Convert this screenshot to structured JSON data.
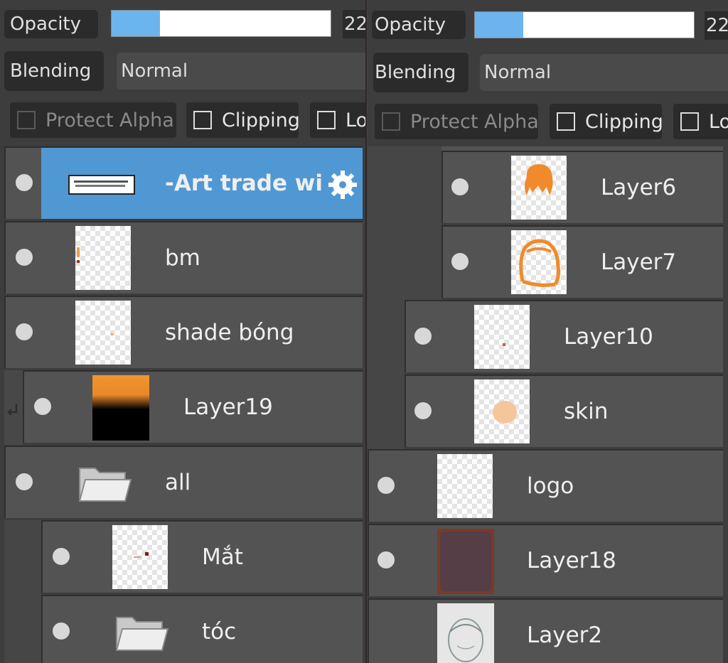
{
  "left": {
    "opacity_label": "Opacity",
    "opacity_value": "22",
    "opacity_fraction": 0.22,
    "blending_label": "Blending",
    "blending_value": "Normal",
    "protect_alpha": "Protect Alpha",
    "clipping": "Clipping",
    "lock": "Lo",
    "layers": [
      {
        "name": "-Art trade wi"
      },
      {
        "name": "bm"
      },
      {
        "name": "shade bóng"
      },
      {
        "name": "Layer19"
      },
      {
        "name": "all"
      },
      {
        "name": "Mắt"
      },
      {
        "name": "tóc"
      }
    ]
  },
  "right": {
    "opacity_label": "Opacity",
    "opacity_value": "22",
    "opacity_fraction": 0.22,
    "blending_label": "Blending",
    "blending_value": "Normal",
    "protect_alpha": "Protect Alpha",
    "clipping": "Clipping",
    "lock": "Lo",
    "layers": [
      {
        "name": "Layer6"
      },
      {
        "name": "Layer7"
      },
      {
        "name": "Layer10"
      },
      {
        "name": "skin"
      },
      {
        "name": "logo"
      },
      {
        "name": "Layer18"
      },
      {
        "name": "Layer2"
      }
    ]
  },
  "colors": {
    "selected": "#4f98d4",
    "slider_fill": "#6cb4ee",
    "row": "#535353",
    "panel": "#3d3d3d"
  },
  "icons": [
    "visibility-dot-icon",
    "folder-icon",
    "settings-gear-icon",
    "clip-arrow-icon"
  ]
}
